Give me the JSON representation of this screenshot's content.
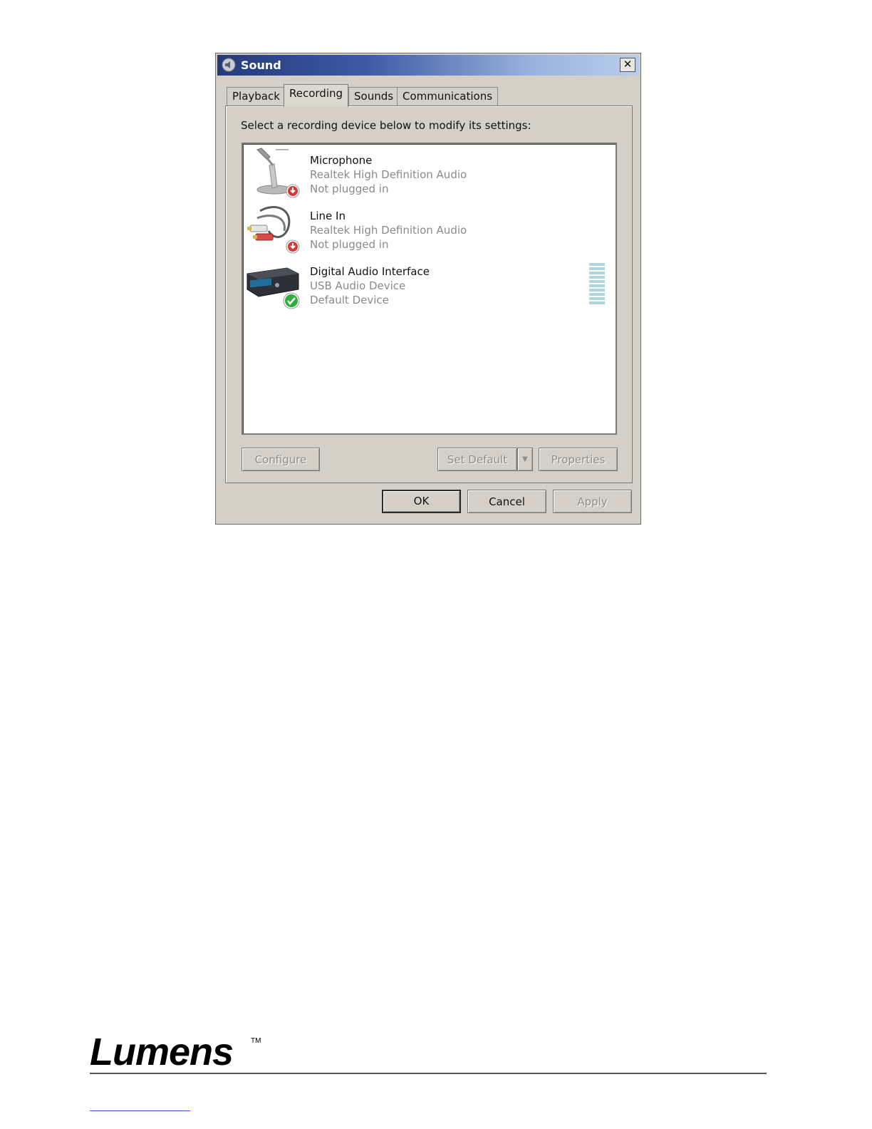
{
  "window": {
    "title": "Sound",
    "close_label": "✕"
  },
  "tabs": [
    {
      "label": "Playback",
      "active": false
    },
    {
      "label": "Recording",
      "active": true
    },
    {
      "label": "Sounds",
      "active": false
    },
    {
      "label": "Communications",
      "active": false
    }
  ],
  "recording": {
    "instruction": "Select a recording device below to modify its settings:",
    "devices": [
      {
        "name": "Microphone",
        "driver": "Realtek High Definition Audio",
        "status": "Not plugged in",
        "icon": "microphone-icon",
        "badge": "unplugged-badge-icon"
      },
      {
        "name": "Line In",
        "driver": "Realtek High Definition Audio",
        "status": "Not plugged in",
        "icon": "line-in-cable-icon",
        "badge": "unplugged-badge-icon"
      },
      {
        "name": "Digital Audio Interface",
        "driver": "USB Audio Device",
        "status": "Default Device",
        "icon": "audio-interface-icon",
        "badge": "default-check-icon"
      }
    ],
    "buttons": {
      "configure": "Configure",
      "set_default": "Set Default",
      "properties": "Properties"
    }
  },
  "dialog_buttons": {
    "ok": "OK",
    "cancel": "Cancel",
    "apply": "Apply"
  },
  "footer": {
    "brand": "Lumens",
    "trademark": "TM"
  },
  "colors": {
    "badge_red": "#d23a3a",
    "badge_green": "#2fae3a",
    "meter": "#aed6dc"
  }
}
